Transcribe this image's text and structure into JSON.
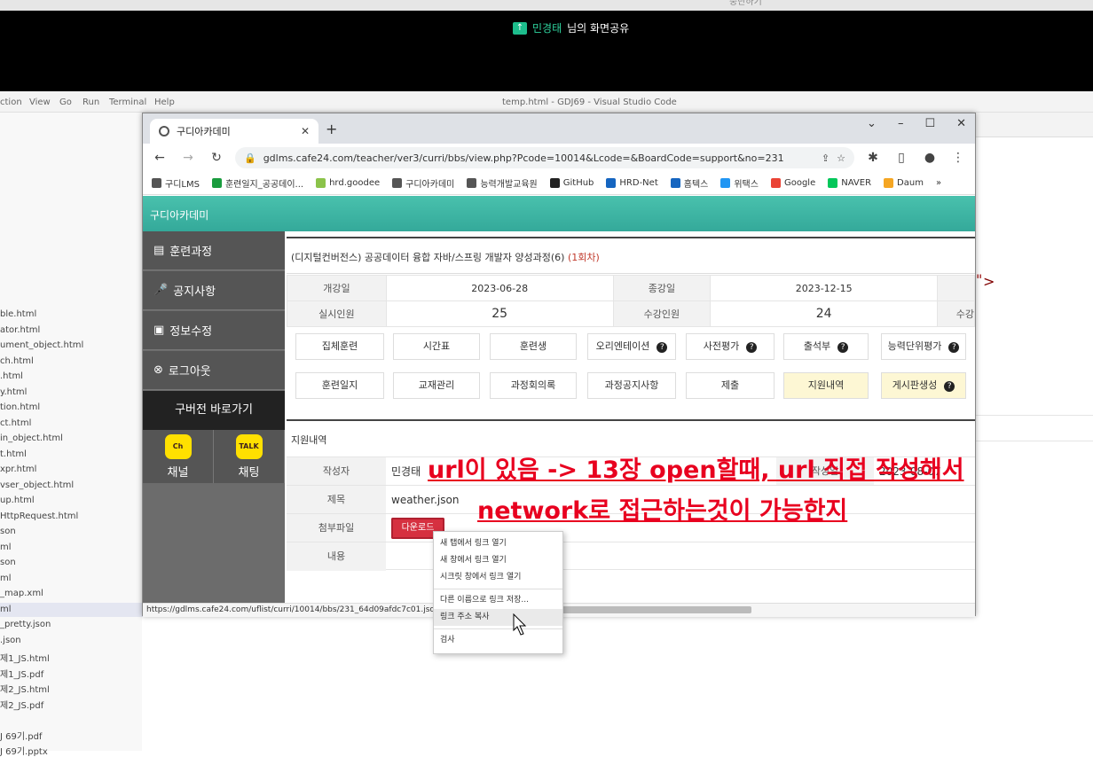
{
  "share": {
    "name": "민경태",
    "suffix": "님의 화면공유",
    "top_hint": "중단하기"
  },
  "vscode": {
    "menus": [
      "ction",
      "View",
      "Go",
      "Run",
      "Terminal",
      "Help"
    ],
    "title": "temp.html - GDJ69 - Visual Studio Code",
    "files": [
      "ble.html",
      "ator.html",
      "ument_object.html",
      "ch.html",
      ".html",
      "y.html",
      "tion.html",
      "ct.html",
      "in_object.html",
      "t.html",
      "xpr.html",
      "vser_object.html",
      "up.html",
      "HttpRequest.html",
      "son",
      "ml",
      "son",
      "ml",
      "_map.xml",
      "ml",
      "_pretty.json",
      ".json",
      "제1_JS.html",
      "제1_JS.pdf",
      "제2_JS.html",
      "제2_JS.pdf",
      "",
      "J 69기.pdf",
      "J 69기.pptx"
    ],
    "code_quote": "\"",
    "code_arrow": ">"
  },
  "browser": {
    "tab_title": "구디아카데미",
    "url": "gdlms.cafe24.com/teacher/ver3/curri/bbs/view.php?Pcode=10014&Lcode=&BoardCode=support&no=231",
    "bookmarks": [
      "구디LMS",
      "훈련일지_공공데이...",
      "hrd.goodee",
      "구디아카데미",
      "능력개발교육원",
      "GitHub",
      "HRD-Net",
      "홈텍스",
      "위택스",
      "Google",
      "NAVER",
      "Daum"
    ],
    "status_url": "https://gdlms.cafe24.com/uflist/curri/10014/bbs/231_64d09afdc7c01.json"
  },
  "site": {
    "header": "구디아카데미",
    "side_menu": [
      "훈련과정",
      "공지사항",
      "정보수정",
      "로그아웃"
    ],
    "old_version": "구버전 바로가기",
    "kakao": [
      {
        "label": "채널",
        "icon": "Ch"
      },
      {
        "label": "채팅",
        "icon": "TALK"
      }
    ],
    "course_title": "(디지털컨버전스) 공공데이터 융합 자바/스프링 개발자 양성과정(6)",
    "course_round": "(1회차)",
    "info": {
      "start_label": "개강일",
      "start": "2023-06-28",
      "end_label": "종강일",
      "end": "2023-12-15",
      "actual_label": "실시인원",
      "actual": "25",
      "enrolled_label": "수강인원",
      "enrolled": "24",
      "cut_label": "수강"
    },
    "menu_row1": [
      "집체훈련",
      "시간표",
      "훈련생",
      "오리엔테이션",
      "사전평가",
      "출석부",
      "능력단위평가"
    ],
    "menu_row2": [
      "훈련일지",
      "교재관리",
      "과정회의록",
      "과정공지사항",
      "제출",
      "지원내역",
      "게시판생성"
    ],
    "support": {
      "title": "지원내역",
      "writer_label": "작성자",
      "writer": "민경태",
      "date_label": "작성일",
      "date": "2023-08-07",
      "subject_label": "제목",
      "subject": "weather.json",
      "file_label": "첨부파일",
      "download": "다운로드",
      "content_label": "내용"
    }
  },
  "context_menu": [
    "새 탭에서 링크 열기",
    "새 창에서 링크 열기",
    "시크릿 창에서 링크 열기",
    "다른 이름으로 링크 저장...",
    "링크 주소 복사",
    "검사"
  ],
  "annotation": {
    "line1": "url이 있음 -> 13장 open할때, url 직접 작성해서 ",
    "line2": "network로 접근하는것이 가능한지 "
  }
}
